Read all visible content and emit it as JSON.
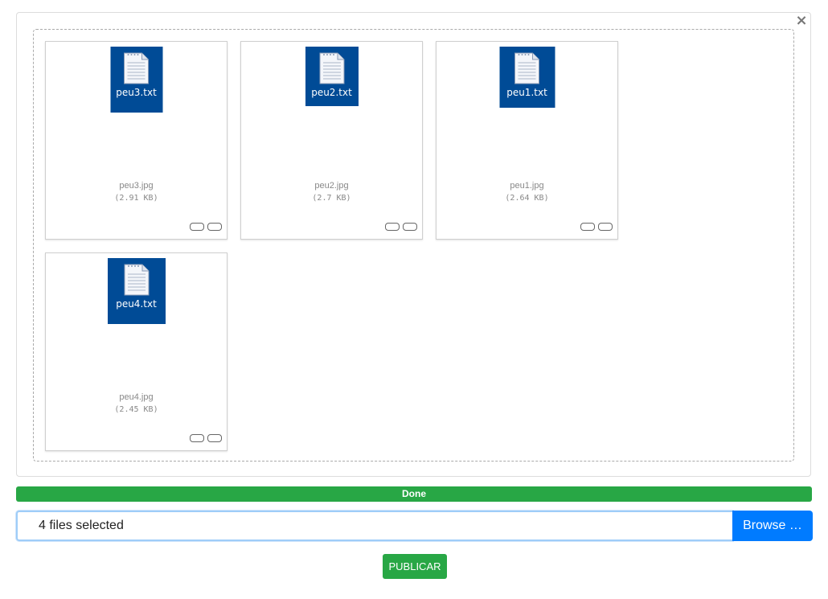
{
  "dialog": {
    "close_label": "×"
  },
  "files": [
    {
      "preview_label": "peu3.txt",
      "name": "peu3.jpg",
      "size": "(2.91 KB)"
    },
    {
      "preview_label": "peu2.txt",
      "name": "peu2.jpg",
      "size": "(2.7 KB)"
    },
    {
      "preview_label": "peu1.txt",
      "name": "peu1.jpg",
      "size": "(2.64 KB)"
    },
    {
      "preview_label": "peu4.txt",
      "name": "peu4.jpg",
      "size": "(2.45 KB)"
    }
  ],
  "progress": {
    "label": "Done",
    "percent": 100,
    "color": "#28a745"
  },
  "file_input": {
    "value": "4 files selected",
    "browse_label": "Browse …"
  },
  "publish_button": {
    "label": "PUBLICAR",
    "color": "#28a745"
  },
  "colors": {
    "preview_bg": "#004b96",
    "primary": "#007bff"
  },
  "icons": {
    "file": "text-file-icon",
    "close": "close-icon"
  }
}
